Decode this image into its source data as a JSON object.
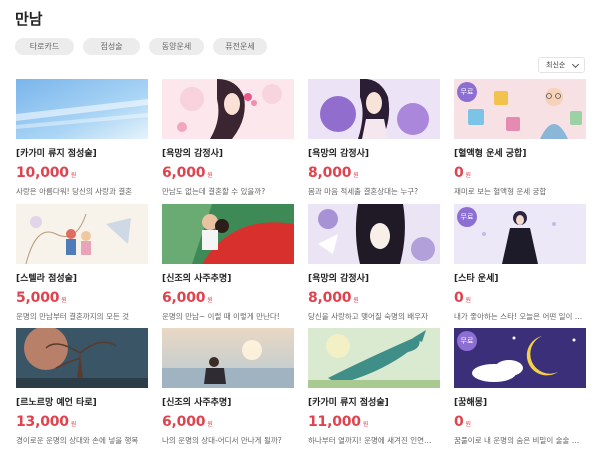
{
  "page": {
    "title": "만남"
  },
  "filters": [
    "타로카드",
    "점성술",
    "동양운세",
    "퓨전운세"
  ],
  "sort": {
    "selected": "최신순"
  },
  "free_label": "무료",
  "currency": "원",
  "cards": [
    {
      "title": "[카가미 류지 점성술]",
      "price": "10,000",
      "desc": "사랑은 아름다워! 당신의 사랑과 결혼",
      "free": false,
      "theme": "sky"
    },
    {
      "title": "[욕망의 감정사]",
      "price": "6,000",
      "desc": "만남도 없는데 결혼할 수 있을까?",
      "free": false,
      "theme": "woman-pink"
    },
    {
      "title": "[욕망의 감정사]",
      "price": "8,000",
      "desc": "몸과 마음 적세출 결혼상대는 누구?",
      "free": false,
      "theme": "woman-purple"
    },
    {
      "title": "[혈액형 운세 궁합]",
      "price": "0",
      "desc": "재미로 보는 혈액형 운세 궁합",
      "free": true,
      "theme": "letters"
    },
    {
      "title": "[스텔라 점성술]",
      "price": "5,000",
      "desc": "운명의 만남부터 결혼까지의 모든 것",
      "free": false,
      "theme": "couple-sketch"
    },
    {
      "title": "[신조의 사주추명]",
      "price": "6,000",
      "desc": "운명의 만남~ 이럴 때 이렇게 만난다!",
      "free": false,
      "theme": "couple-red"
    },
    {
      "title": "[욕망의 감정사]",
      "price": "8,000",
      "desc": "당신을 사랑하고 맺어질 숙명의 배우자",
      "free": false,
      "theme": "woman-lily"
    },
    {
      "title": "[스타 운세]",
      "price": "0",
      "desc": "내가 좋아하는 스타! 오늘은 어떤 일이 …",
      "free": true,
      "theme": "star-lady"
    },
    {
      "title": "[르노르망 예언 타로]",
      "price": "13,000",
      "desc": "경이로운 운명의 상대와 손에 넣을 행복",
      "free": false,
      "theme": "tree"
    },
    {
      "title": "[신조의 사주추명]",
      "price": "6,000",
      "desc": "나의 운명의 상대-어디서 만나게 될까?",
      "free": false,
      "theme": "beach"
    },
    {
      "title": "[카가미 류지 점성술]",
      "price": "11,000",
      "desc": "하나부터 열까지! 운명에 새겨진 인연…",
      "free": false,
      "theme": "whale"
    },
    {
      "title": "[꿈해몽]",
      "price": "0",
      "desc": "꿈풀이로 내 운명의 숨은 비밀이 술술 …",
      "free": true,
      "theme": "moon"
    }
  ]
}
